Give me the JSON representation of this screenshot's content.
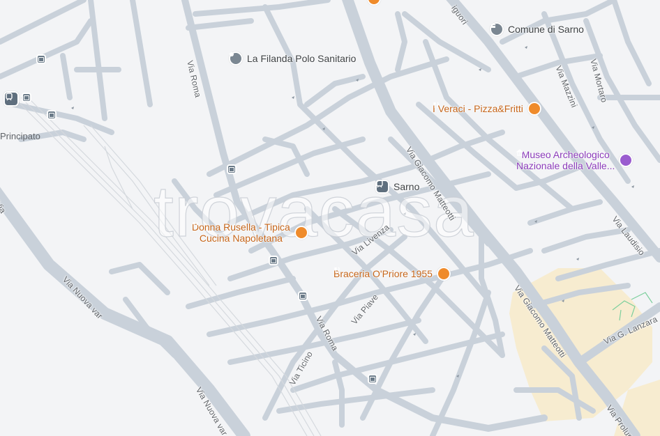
{
  "map": {
    "colors": {
      "background": "#f3f4f6",
      "road": "#c9d1da",
      "highlight_area": "#f7ecd0",
      "food": "#ef8b2b",
      "transit": "#6a7a88",
      "museum": "#9a5ccf"
    },
    "watermark": "trovacasa",
    "partial_label": "Principato",
    "pois": {
      "comune": {
        "label": "Comune di Sarno",
        "icon": "town-hall-icon"
      },
      "filanda": {
        "label": "La Filanda Polo Sanitario",
        "icon": "place-icon"
      },
      "veraci": {
        "label": "I Veraci - Pizza&Fritti",
        "icon": "restaurant-icon"
      },
      "museo": {
        "label_line1": "Museo Archeologico",
        "label_line2": "Nazionale della Valle...",
        "icon": "museum-icon"
      },
      "sarno": {
        "label": "Sarno",
        "icon": "train-station-icon"
      },
      "donna": {
        "label_line1": "Donna Rusella - Tipica",
        "label_line2": "Cucina Napoletana",
        "icon": "restaurant-icon"
      },
      "braceria": {
        "label": "Braceria O'Priore 1955",
        "icon": "restaurant-icon"
      }
    },
    "streets": {
      "roma_north": "Via Roma",
      "roma_south": "Via Roma",
      "matteotti_north": "Via Giacomo Matteotti",
      "matteotti_south": "Via Giacomo Matteotti",
      "liguori": "iguori",
      "mazzini": "Via Mazzini",
      "mortaro": "Via Mortaro",
      "laudisio": "Via Laudisio",
      "lanzara": "Via G. Lanzara",
      "prolungamento": "Via Prolung",
      "livenza": "Via Livenza",
      "piave": "Via Piave",
      "ticino": "Via Ticino",
      "nuova_var_1": "Via Nuova var",
      "nuova_var_2": "Via Nuova var",
      "edge_var": "Via"
    }
  }
}
